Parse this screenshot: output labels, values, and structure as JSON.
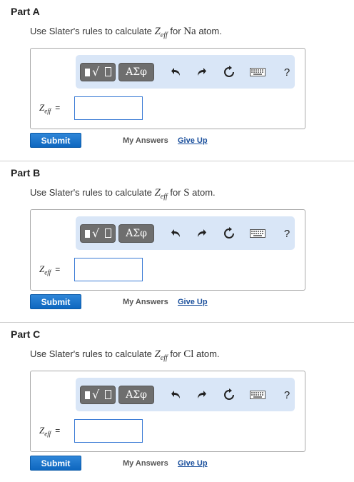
{
  "parts": [
    {
      "title": "Part A",
      "question_prefix": "Use Slater's rules to calculate ",
      "z_symbol": "Z",
      "z_sub": "eff",
      "question_mid": " for ",
      "element": "Na",
      "question_suffix": " atom.",
      "input_value": ""
    },
    {
      "title": "Part B",
      "question_prefix": "Use Slater's rules to calculate ",
      "z_symbol": "Z",
      "z_sub": "eff",
      "question_mid": " for ",
      "element": "S",
      "question_suffix": " atom.",
      "input_value": ""
    },
    {
      "title": "Part C",
      "question_prefix": "Use Slater's rules to calculate ",
      "z_symbol": "Z",
      "z_sub": "eff",
      "question_mid": " for ",
      "element": "Cl",
      "question_suffix": " atom.",
      "input_value": ""
    }
  ],
  "toolbar": {
    "greek_label": "ΑΣφ",
    "help_label": "?",
    "icons": [
      "templates-icon",
      "greek-symbols",
      "undo-icon",
      "redo-icon",
      "reset-icon",
      "keyboard-icon",
      "help-icon"
    ]
  },
  "answer_label": {
    "symbol": "Z",
    "sub": "eff",
    "equals": "="
  },
  "actions": {
    "submit_label": "Submit",
    "my_answers_label": "My Answers",
    "give_up_label": "Give Up"
  },
  "colors": {
    "submit_bg": "#1a73c9",
    "toolbar_bg": "#d9e6f7",
    "input_border": "#3a7bd5",
    "give_up_link": "#1a4f9c"
  }
}
